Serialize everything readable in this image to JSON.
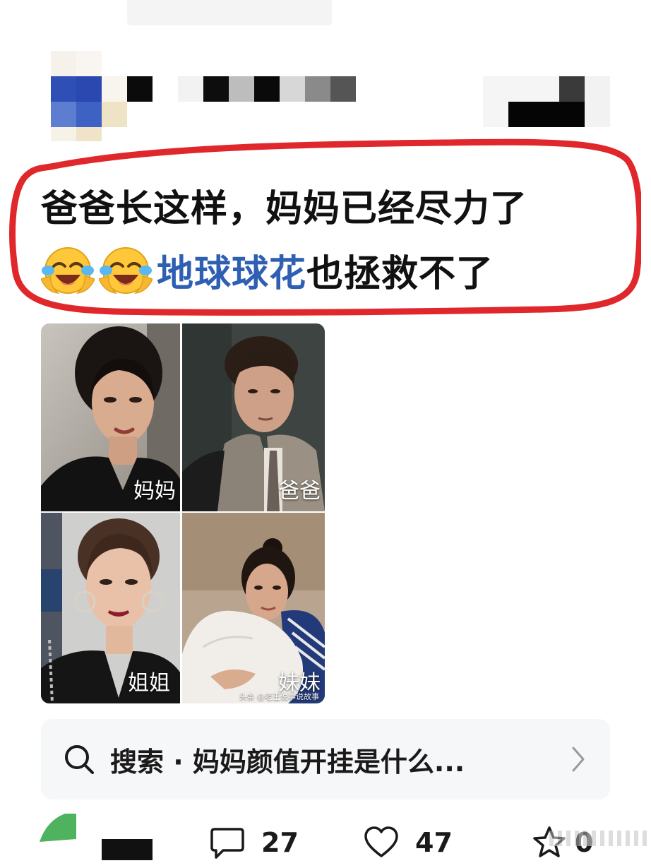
{
  "post": {
    "caption_line1": "爸爸长这样，妈妈已经尽力了",
    "caption_hashtag": "地球球花",
    "caption_line2_rest": "也拯救不了",
    "emoji": "laughing-crying-emoji"
  },
  "photos": [
    {
      "label": "妈妈"
    },
    {
      "label": "爸爸"
    },
    {
      "label": "姐姐"
    },
    {
      "label": "妹妹"
    }
  ],
  "watermark": "头条 @老王说事说故事",
  "search": {
    "text": "搜索 · 妈妈颜值开挂是什么..."
  },
  "actions": {
    "comments": "27",
    "likes": "47",
    "shares": "0"
  },
  "colors": {
    "ring": "#e0272b",
    "hashtag": "#2f5fb3",
    "search_bg": "#f6f7f9"
  }
}
